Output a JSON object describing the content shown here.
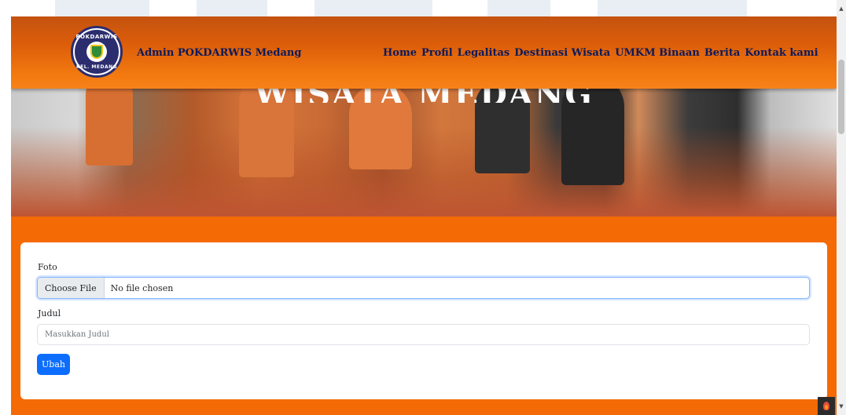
{
  "header": {
    "brand": "Admin POKDARWIS Medang",
    "logo_text_top": "POKDARWIS",
    "logo_text_bottom": "KEL. MEDANG",
    "nav": [
      "Home",
      "Profil",
      "Legalitas",
      "Destinasi Wisata",
      "UMKM Binaan",
      "Berita",
      "Kontak kami"
    ]
  },
  "hero": {
    "title": "WISATA MEDANG"
  },
  "form": {
    "foto_label": "Foto",
    "file_button": "Choose File",
    "file_status": "No file chosen",
    "judul_label": "Judul",
    "judul_placeholder": "Masukkan Judul",
    "submit": "Ubah"
  },
  "colors": {
    "accent": "#f46a05",
    "nav_text": "#0b1a5c",
    "primary_button": "#0d6efd"
  },
  "icons": {
    "scroll_up": "▲",
    "scroll_down": "▼",
    "fab": "flame-icon"
  }
}
